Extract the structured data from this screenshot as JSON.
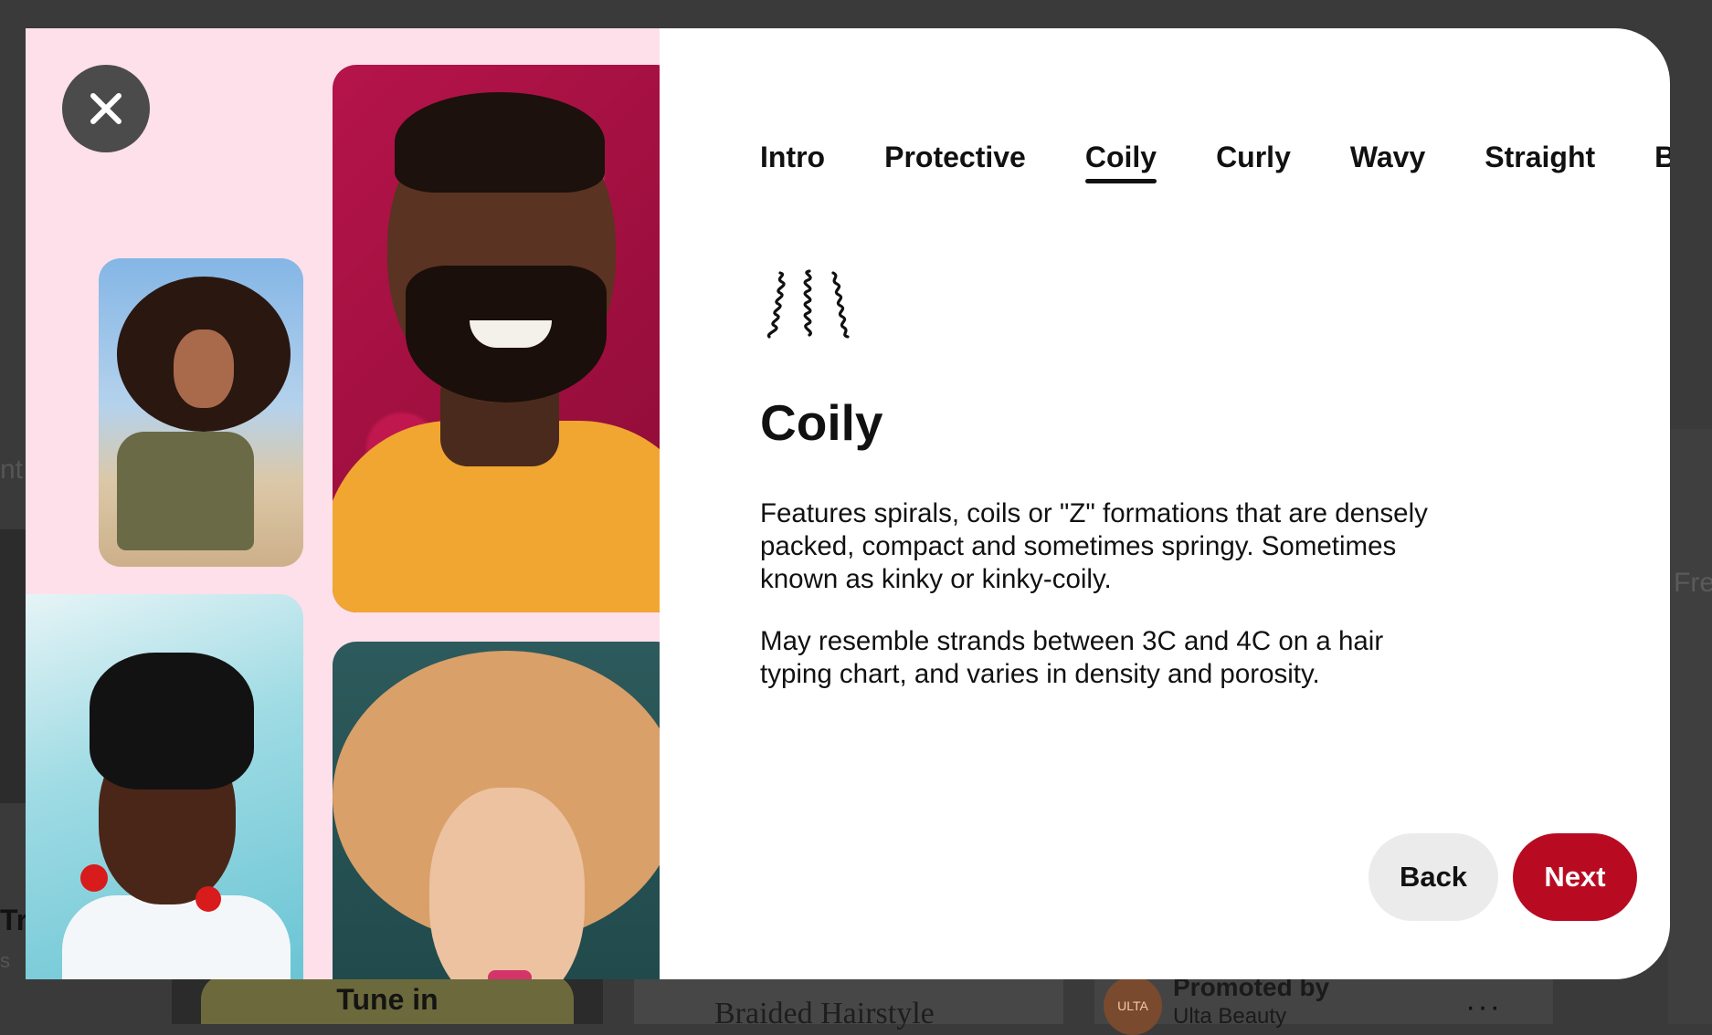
{
  "background": {
    "left_partial_text_1": "nt l",
    "left_partial_text_2": "Tr",
    "left_partial_text_3": "s",
    "right_partial_text": "Fre",
    "tune_in_label": "Tune in",
    "braided_label": "Braided Hairstyle",
    "promoted_by": "Promoted by",
    "advertiser_name": "Ulta Beauty",
    "advertiser_logo_text": "ULTA",
    "more_icon": "···"
  },
  "modal": {
    "close_icon": "close-icon",
    "tabs": [
      {
        "label": "Intro",
        "active": false
      },
      {
        "label": "Protective",
        "active": false
      },
      {
        "label": "Coily",
        "active": true
      },
      {
        "label": "Curly",
        "active": false
      },
      {
        "label": "Wavy",
        "active": false
      },
      {
        "label": "Straight",
        "active": false
      },
      {
        "label": "Ba",
        "active": false
      }
    ],
    "hair_icon": "coily-hair-icon",
    "title": "Coily",
    "paragraphs": [
      "Features spirals, coils or \"Z\" formations that are densely packed, compact and sometimes springy. Sometimes known as kinky or kinky-coily.",
      "May resemble strands between 3C and 4C on a hair typing chart, and varies in density and porosity."
    ],
    "back_label": "Back",
    "next_label": "Next",
    "colors": {
      "left_panel_bg": "#fde0ea",
      "next_button": "#b80b22",
      "back_button": "#ebebeb",
      "close_button": "#4b4b4b"
    }
  }
}
